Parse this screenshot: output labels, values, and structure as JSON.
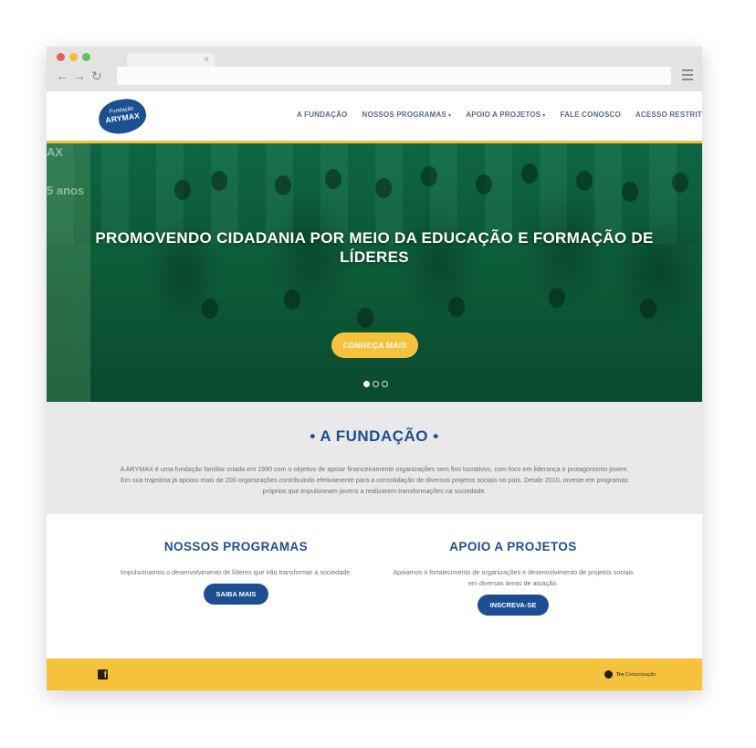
{
  "browser": {
    "tab_close": "×",
    "back": "←",
    "forward": "→",
    "reload": "↻"
  },
  "site": {
    "logo": {
      "small": "Fundação",
      "big": "ARYMAX",
      "color": "#1c4f92"
    },
    "nav": [
      {
        "label": "A FUNDAÇÃO",
        "dropdown": false
      },
      {
        "label": "NOSSOS PROGRAMAS",
        "dropdown": true
      },
      {
        "label": "APOIO A PROJETOS",
        "dropdown": true
      },
      {
        "label": "FALE CONOSCO",
        "dropdown": false
      },
      {
        "label": "ACESSO RESTRITO",
        "dropdown": false
      }
    ],
    "caret": "▾"
  },
  "hero": {
    "side_text_1": "AX",
    "side_text_2": "5 anos",
    "title_line1": "PROMOVENDO CIDADANIA POR MEIO DA EDUCAÇÃO E FORMAÇÃO DE",
    "title_line2": "LÍDERES",
    "cta": "CONHEÇA MAIS",
    "slides": 3,
    "active_slide": 1
  },
  "fundacao": {
    "title": "• A FUNDAÇÃO •",
    "text_line1": "A ARYMAX é uma fundação familiar criada em 1990 com o objetivo de apoiar financeiramente organizações sem fins lucrativos, com foco em liderança e protagonismo jovem.",
    "text_line2": "Em sua trajetória já apoiou mais de 200 organizações contribuindo efetivamente para a consolidação de diversos projetos sociais no país. Desde 2010, investe em programas",
    "text_line3": "próprios que impulsionam jovens a realizarem transformações na sociedade."
  },
  "programas": {
    "title": "NOSSOS PROGRAMAS",
    "text": "Impulsionamos o desenvolvimento de líderes que irão transformar a sociedade.",
    "button": "SAIBA MAIS"
  },
  "apoio": {
    "title": "APOIO A PROJETOS",
    "text_line1": "Apoiamos o fortalecimento de organizações e desenvolvimento de projetos sociais",
    "text_line2": "em diversas áreas de atuação.",
    "button": "INSCREVA-SE"
  },
  "footer": {
    "facebook": "f",
    "credit_bold": "Tre",
    "credit_rest": "Comunicação",
    "color": "#f7c23b"
  },
  "colors": {
    "accent": "#f7c23b",
    "brand": "#1c4f92",
    "hero_overlay": "#0f6b45"
  }
}
